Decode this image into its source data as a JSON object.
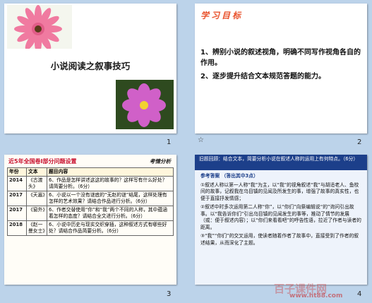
{
  "slides": [
    {
      "number": "1",
      "title": "小说阅读之叙事技巧"
    },
    {
      "number": "2",
      "heading": "学习目标",
      "points": [
        "1、辨别小说的叙述视角，明确不同写作视角各自的作用。",
        "2、逐步提升结合文本规范答题的能力。"
      ]
    },
    {
      "number": "3",
      "heading": "近5年全国卷I部分问题设置",
      "tag": "考情分析",
      "columns": [
        "年份",
        "文本",
        "题目内容"
      ],
      "rows": [
        {
          "year": "2014",
          "text": "《古渡头》",
          "q": "6、作品是怎样讲述这这的故事的？这样写有什么好处？请简要分析。（6分）"
        },
        {
          "year": "2017",
          "text": "《天嚣》",
          "q": "6、小说以一个没有谜底的“无赵的谜”结尾，这样处理有怎样的艺术效果？请结合作品进行分析。（6分）"
        },
        {
          "year": "2017",
          "text": "《窗外》",
          "q": "6、作者交替使用“你”和“我”两个不同的人称，其中蕴涵着怎样的态度？请结合全文进行分析。（6分）"
        },
        {
          "year": "2018",
          "text": "《赵一曼女士》",
          "q": "6、小说中历史与现实交织穿插，这种叙述方式有哪些好处？请结合作品简要分析。（6分）"
        }
      ]
    },
    {
      "number": "4",
      "header": "旧题回顾：结合文本，简要分析小说在叙述人称的运用上有何特点。（6分）",
      "answer_label": "参考答案 （答出其中3点）",
      "points": [
        "①叙述人称以第一人称“我”为主，以“我”的视角叙述“我”与胡适老人、鱼校间的故事，记叙我在乌目镇的见闻及所发生的事，增强了故事的真实性，也便于直接抒发情感；",
        "②叙述中时多次运用第二人称“你”，以“你们”向祭编辑说“的”询问引出故事。以“我告诉你们”引出乌目镇的见闻发生的事等，推动了情节的发展（或：便于叙述内容）；以“你们来看看吧”的呼告性语，拉近了作者与读者的距离。",
        "③“我”“你们”的交叉运用，使读者随着作者了故事中，直接受到了作者的叙述结果，从而深化了主题。"
      ]
    }
  ],
  "watermark": {
    "brand": "百子课件网",
    "url": "www.ht88.com"
  }
}
